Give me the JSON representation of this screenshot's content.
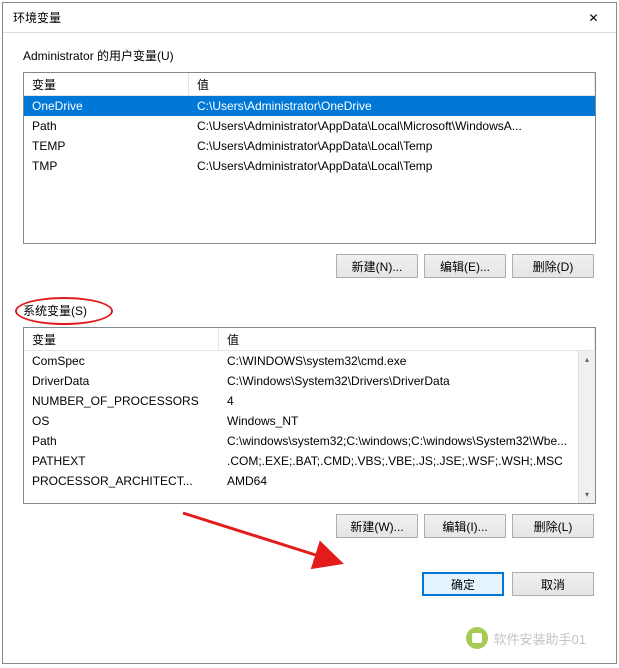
{
  "titlebar": {
    "title": "环境变量",
    "close": "✕"
  },
  "user_vars": {
    "label": "Administrator 的用户变量(U)",
    "col_name": "变量",
    "col_value": "值",
    "rows": [
      {
        "name": "OneDrive",
        "value": "C:\\Users\\Administrator\\OneDrive",
        "selected": true
      },
      {
        "name": "Path",
        "value": "C:\\Users\\Administrator\\AppData\\Local\\Microsoft\\WindowsA..."
      },
      {
        "name": "TEMP",
        "value": "C:\\Users\\Administrator\\AppData\\Local\\Temp"
      },
      {
        "name": "TMP",
        "value": "C:\\Users\\Administrator\\AppData\\Local\\Temp"
      }
    ],
    "buttons": {
      "new": "新建(N)...",
      "edit": "编辑(E)...",
      "delete": "删除(D)"
    }
  },
  "system_vars": {
    "label": "系统变量(S)",
    "col_name": "变量",
    "col_value": "值",
    "rows": [
      {
        "name": "ComSpec",
        "value": "C:\\WINDOWS\\system32\\cmd.exe"
      },
      {
        "name": "DriverData",
        "value": "C:\\Windows\\System32\\Drivers\\DriverData"
      },
      {
        "name": "NUMBER_OF_PROCESSORS",
        "value": "4"
      },
      {
        "name": "OS",
        "value": "Windows_NT"
      },
      {
        "name": "Path",
        "value": "C:\\windows\\system32;C:\\windows;C:\\windows\\System32\\Wbe..."
      },
      {
        "name": "PATHEXT",
        "value": ".COM;.EXE;.BAT;.CMD;.VBS;.VBE;.JS;.JSE;.WSF;.WSH;.MSC"
      },
      {
        "name": "PROCESSOR_ARCHITECT...",
        "value": "AMD64"
      }
    ],
    "buttons": {
      "new": "新建(W)...",
      "edit": "编辑(I)...",
      "delete": "删除(L)"
    }
  },
  "bottom": {
    "ok": "确定",
    "cancel": "取消"
  },
  "watermark": {
    "text": "软件安装助手01"
  }
}
